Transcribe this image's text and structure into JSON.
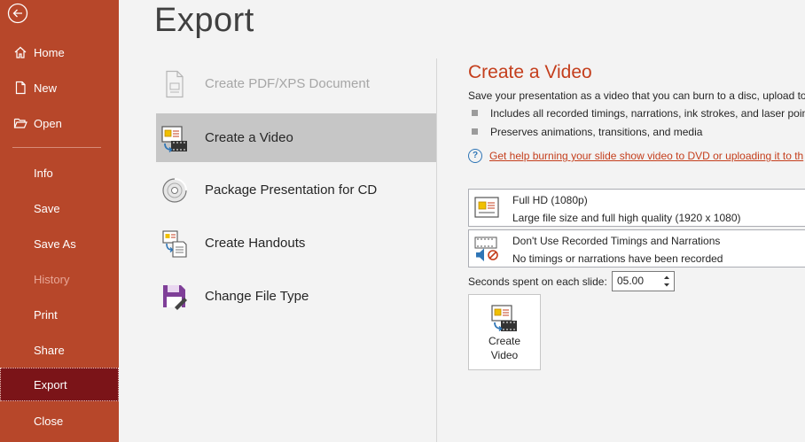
{
  "sidebar": {
    "items": [
      {
        "label": "Home"
      },
      {
        "label": "New"
      },
      {
        "label": "Open"
      },
      {
        "label": "Info"
      },
      {
        "label": "Save"
      },
      {
        "label": "Save As"
      },
      {
        "label": "History"
      },
      {
        "label": "Print"
      },
      {
        "label": "Share"
      },
      {
        "label": "Export"
      },
      {
        "label": "Close"
      }
    ],
    "bg_color": "#b7472a",
    "active_color": "#7b1418"
  },
  "main": {
    "title": "Export",
    "options": [
      {
        "label": "Create PDF/XPS Document",
        "icon": "pdf-document-icon"
      },
      {
        "label": "Create a Video",
        "icon": "video-icon"
      },
      {
        "label": "Package Presentation for CD",
        "icon": "cd-icon"
      },
      {
        "label": "Create Handouts",
        "icon": "handouts-icon"
      },
      {
        "label": "Change File Type",
        "icon": "save-disk-icon"
      }
    ]
  },
  "video_panel": {
    "title": "Create a Video",
    "description": "Save your presentation as a video that you can burn to a disc, upload to t",
    "bullets": [
      "Includes all recorded timings, narrations, ink strokes, and laser point",
      "Preserves animations, transitions, and media"
    ],
    "help_link": "Get help burning your slide show video to DVD or uploading it to th",
    "quality": {
      "title": "Full HD (1080p)",
      "subtitle": "Large file size and full high quality (1920 x 1080)"
    },
    "timings": {
      "title": "Don't Use Recorded Timings and Narrations",
      "subtitle": "No timings or narrations have been recorded"
    },
    "seconds_label": "Seconds spent on each slide:",
    "seconds_value": "05.00",
    "create_button": {
      "line1": "Create",
      "line2": "Video"
    },
    "accent_color": "#c43e1c"
  }
}
